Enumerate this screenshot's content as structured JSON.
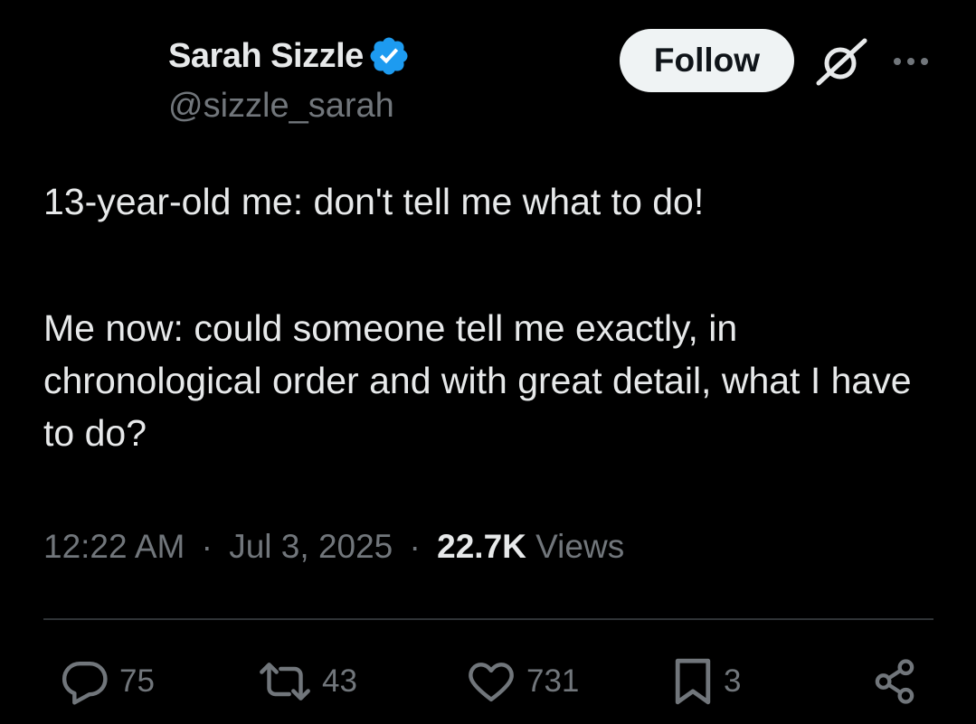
{
  "author": {
    "name": "Sarah Sizzle",
    "handle": "@sizzle_sarah",
    "verified": true,
    "verified_color": "#1d9bf0"
  },
  "header": {
    "follow_label": "Follow",
    "icons": [
      "verified-badge-icon",
      "grok-icon",
      "more-icon"
    ]
  },
  "tweet": {
    "line1": "13-year-old me: don't tell me what to do!",
    "line2": "Me now: could someone tell me exactly, in chronological order and with great detail, what I have to do?"
  },
  "meta": {
    "time": "12:22 AM",
    "date": "Jul 3, 2025",
    "views_count": "22.7K",
    "views_label": "Views",
    "separator": "·"
  },
  "actions": {
    "replies": "75",
    "reposts": "43",
    "likes": "731",
    "bookmarks": "3",
    "icons": [
      "reply-icon",
      "repost-icon",
      "like-icon",
      "bookmark-icon",
      "share-icon"
    ]
  },
  "colors": {
    "background": "#000000",
    "primary_text": "#e7e9ea",
    "secondary_text": "#71767b",
    "divider": "#2f3336",
    "follow_bg": "#eff3f4",
    "follow_text": "#0f1419"
  }
}
